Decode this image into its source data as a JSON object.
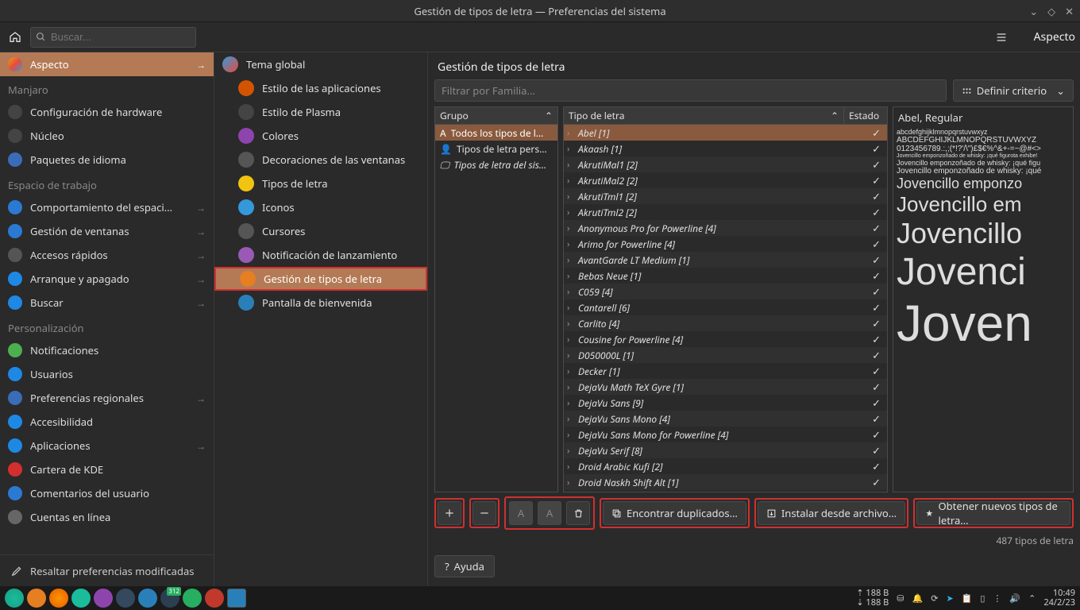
{
  "window": {
    "title": "Gestión de tipos de letra — Preferencias del sistema"
  },
  "toolbar": {
    "search_placeholder": "Buscar...",
    "panel_title": "Aspecto"
  },
  "sidebar": {
    "top_item": "Aspecto",
    "sections": [
      {
        "title": "Manjaro",
        "items": [
          {
            "label": "Configuración de hardware",
            "arrow": false,
            "color": "#444"
          },
          {
            "label": "Núcleo",
            "arrow": false,
            "color": "#444"
          },
          {
            "label": "Paquetes de idioma",
            "arrow": false,
            "color": "#3b6cb8"
          }
        ]
      },
      {
        "title": "Espacio de trabajo",
        "items": [
          {
            "label": "Comportamiento del espaci…",
            "arrow": true,
            "color": "#2a7ad4"
          },
          {
            "label": "Gestión de ventanas",
            "arrow": true,
            "color": "#2a7ad4"
          },
          {
            "label": "Accesos rápidos",
            "arrow": true,
            "color": "#555"
          },
          {
            "label": "Arranque y apagado",
            "arrow": true,
            "color": "#1e88e5"
          },
          {
            "label": "Buscar",
            "arrow": true,
            "color": "#1e88e5"
          }
        ]
      },
      {
        "title": "Personalización",
        "items": [
          {
            "label": "Notificaciones",
            "arrow": false,
            "color": "#4caf50"
          },
          {
            "label": "Usuarios",
            "arrow": false,
            "color": "#1e88e5"
          },
          {
            "label": "Preferencias regionales",
            "arrow": true,
            "color": "#3b6cb8"
          },
          {
            "label": "Accesibilidad",
            "arrow": false,
            "color": "#1e88e5"
          },
          {
            "label": "Aplicaciones",
            "arrow": true,
            "color": "#1e88e5"
          },
          {
            "label": "Cartera de KDE",
            "arrow": false,
            "color": "#d32f2f"
          },
          {
            "label": "Comentarios del usuario",
            "arrow": false,
            "color": "#2a7ad4"
          },
          {
            "label": "Cuentas en línea",
            "arrow": false,
            "color": "#666"
          }
        ]
      }
    ],
    "footer": "Resaltar preferencias modificadas"
  },
  "middle": {
    "header": "Tema global",
    "items": [
      {
        "label": "Estilo de las aplicaciones",
        "color": "#d35400"
      },
      {
        "label": "Estilo de Plasma",
        "color": "#444"
      },
      {
        "label": "Colores",
        "color": "#8e44ad"
      },
      {
        "label": "Decoraciones de las ventanas",
        "color": "#555"
      },
      {
        "label": "Tipos de letra",
        "color": "#f1c40f"
      },
      {
        "label": "Iconos",
        "color": "#3498db"
      },
      {
        "label": "Cursores",
        "color": "#555"
      },
      {
        "label": "Notificación de lanzamiento",
        "color": "#9b59b6"
      },
      {
        "label": "Gestión de tipos de letra",
        "color": "#e67e22",
        "selected": true
      },
      {
        "label": "Pantalla de bienvenida",
        "color": "#2980b9"
      }
    ]
  },
  "content": {
    "title": "Gestión de tipos de letra",
    "filter_placeholder": "Filtrar por Familia...",
    "criteria_btn": "Definir criterio",
    "group_header": "Grupo",
    "type_header": "Tipo de letra",
    "state_header": "Estado",
    "groups": [
      {
        "label": "Todos los tipos de l…",
        "selected": true,
        "icon": "A"
      },
      {
        "label": "Tipos de letra pers…",
        "icon": "👤"
      },
      {
        "label": "Tipos de letra del sis…",
        "italic": true,
        "icon": "🖵"
      }
    ],
    "fonts": [
      "Abel [1]",
      "Akaash [1]",
      "AkrutiMal1 [2]",
      "AkrutiMal2 [2]",
      "AkrutiTml1 [2]",
      "AkrutiTml2 [2]",
      "Anonymous Pro for Powerline [4]",
      "Arimo for Powerline [4]",
      "AvantGarde LT Medium [1]",
      "Bebas Neue [1]",
      "C059 [4]",
      "Cantarell [6]",
      "Carlito [4]",
      "Cousine for Powerline [4]",
      "D050000L [1]",
      "Decker [1]",
      "DejaVu Math TeX Gyre [1]",
      "DejaVu Sans [9]",
      "DejaVu Sans Mono [4]",
      "DejaVu Sans Mono for Powerline [4]",
      "DejaVu Serif [8]",
      "Droid Arabic Kufi [2]",
      "Droid Naskh Shift Alt [1]"
    ],
    "preview": {
      "title": "Abel, Regular",
      "lines": [
        "abcdefghijklmnopqrstuvwxyz",
        "ABCDEFGHIJKLMNOPQRSTUVWXYZ",
        "0123456789.:,;(*!?'/\\\")£$€%^&+-=~@#<>",
        "Jovencillo emponzoñado de whisky: ¡qué figurota exhibe!",
        "Jovencillo emponzoñado de whisky: ¡qué figu",
        "Jovencillo emponzoñado de whisky: ¡qué",
        "Jovencillo emponzo",
        "Jovencillo em",
        "Jovencillo",
        "Jovenci",
        "Joven"
      ]
    },
    "actions": {
      "find_dup": "Encontrar duplicados…",
      "install": "Instalar desde archivo…",
      "get_new": "Obtener nuevos tipos de letra…"
    },
    "count": "487 tipos de letra",
    "help": "Ayuda"
  },
  "taskbar": {
    "net_up": "188 B",
    "net_down": "188 B",
    "time": "10:49",
    "date": "24/2/23"
  }
}
